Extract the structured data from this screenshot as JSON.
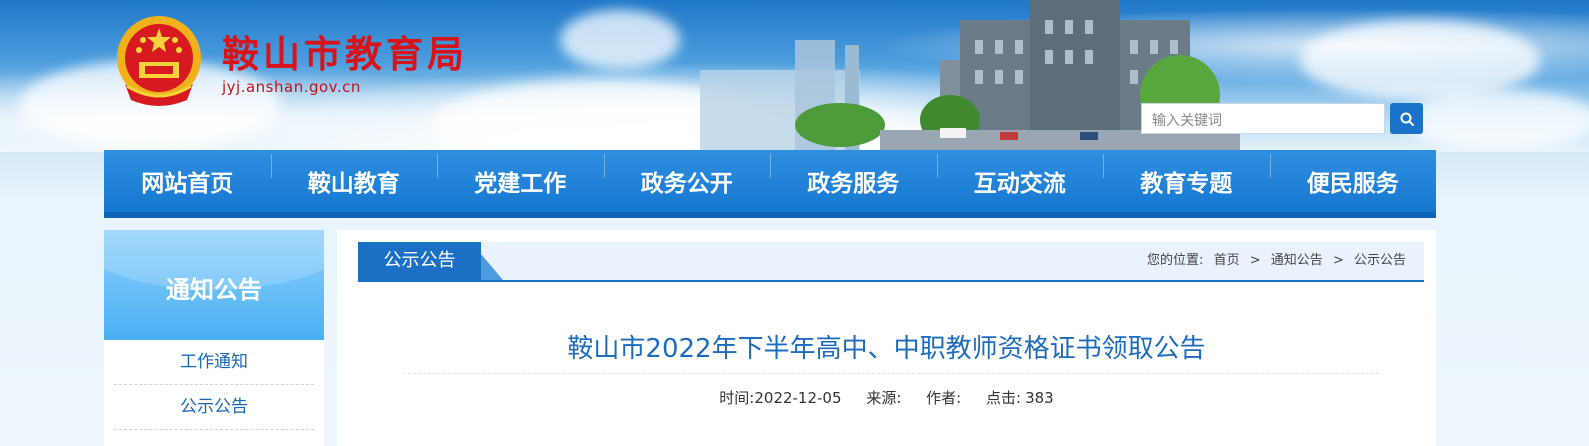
{
  "site": {
    "title": "鞍山市教育局",
    "url": "jyj.anshan.gov.cn"
  },
  "search": {
    "placeholder": "输入关键词",
    "icon": "search-icon"
  },
  "nav": {
    "items": [
      "网站首页",
      "鞍山教育",
      "党建工作",
      "政务公开",
      "政务服务",
      "互动交流",
      "教育专题",
      "便民服务"
    ]
  },
  "sidebar": {
    "title": "通知公告",
    "items": [
      "工作通知",
      "公示公告"
    ]
  },
  "breadcrumb": {
    "tab": "公示公告",
    "label": "您的位置:",
    "path": [
      "首页",
      "通知公告",
      "公示公告"
    ],
    "separator": ">"
  },
  "article": {
    "title": "鞍山市2022年下半年高中、中职教师资格证书领取公告",
    "time": "时间:2022-12-05",
    "source": "来源:",
    "author": "作者:",
    "hits_label": "点击:",
    "hits": "383"
  },
  "colors": {
    "brand_red": "#d8141a",
    "nav_blue": "#1677d0",
    "link_blue": "#1a67b8"
  }
}
